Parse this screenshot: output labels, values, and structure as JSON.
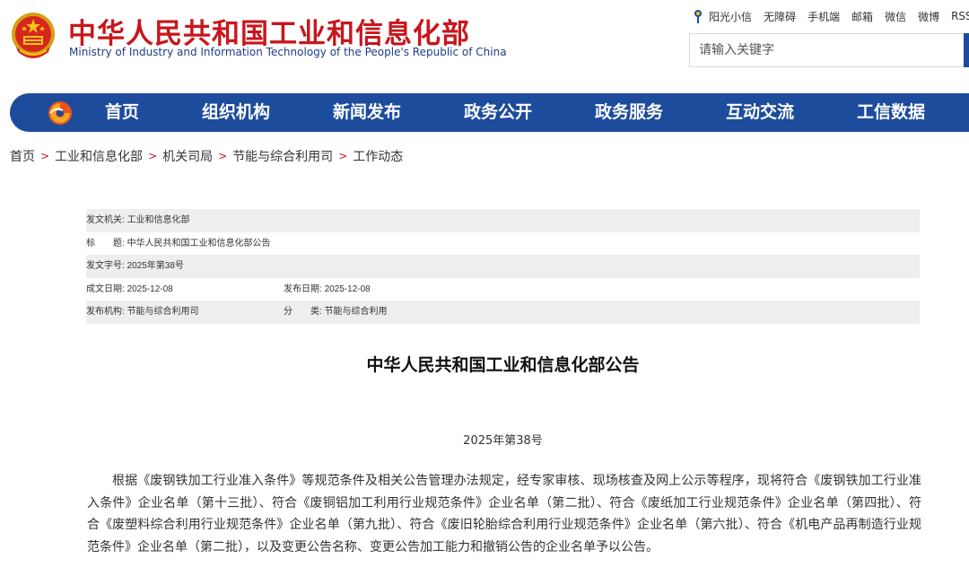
{
  "header": {
    "title": "中华人民共和国工业和信息化部",
    "subtitle": "Ministry of Industry and Information Technology of the People's Republic of China",
    "top_links": [
      "阳光小信",
      "无障碍",
      "手机端",
      "邮箱",
      "微信",
      "微博",
      "RSS"
    ],
    "search_placeholder": "请输入关键字"
  },
  "nav": {
    "items": [
      "首页",
      "组织机构",
      "新闻发布",
      "政务公开",
      "政务服务",
      "互动交流",
      "工信数据"
    ]
  },
  "breadcrumb": [
    "首页",
    "工业和信息化部",
    "机关司局",
    "节能与综合利用司",
    "工作动态"
  ],
  "meta": {
    "issuer_label": "发文机关:",
    "issuer": "工业和信息化部",
    "title_label": "标　　题:",
    "title": "中华人民共和国工业和信息化部公告",
    "doc_no_label": "发文字号:",
    "doc_no": "2025年第38号",
    "created_label": "成文日期:",
    "created": "2025-12-08",
    "published_label": "发布日期:",
    "published": "2025-12-08",
    "org_label": "发布机构:",
    "org": "节能与综合利用司",
    "category_label": "分　　类:",
    "category": "节能与综合利用"
  },
  "article": {
    "title": "中华人民共和国工业和信息化部公告",
    "number": "2025年第38号",
    "body": "根据《废钢铁加工行业准入条件》等规范条件及相关公告管理办法规定，经专家审核、现场核查及网上公示等程序，现将符合《废钢铁加工行业准入条件》企业名单（第十三批）、符合《废铜铝加工利用行业规范条件》企业名单（第二批）、符合《废纸加工行业规范条件》企业名单（第四批）、符合《废塑料综合利用行业规范条件》企业名单（第九批）、符合《废旧轮胎综合利用行业规范条件》企业名单（第六批）、符合《机电产品再制造行业规范条件》企业名单（第二批），以及变更公告名称、变更公告加工能力和撤销公告的企业名单予以公告。"
  },
  "colors": {
    "brand_red": "#c8161d",
    "nav_blue": "#1d4c9c",
    "meta_shade": "#eeeeee"
  }
}
